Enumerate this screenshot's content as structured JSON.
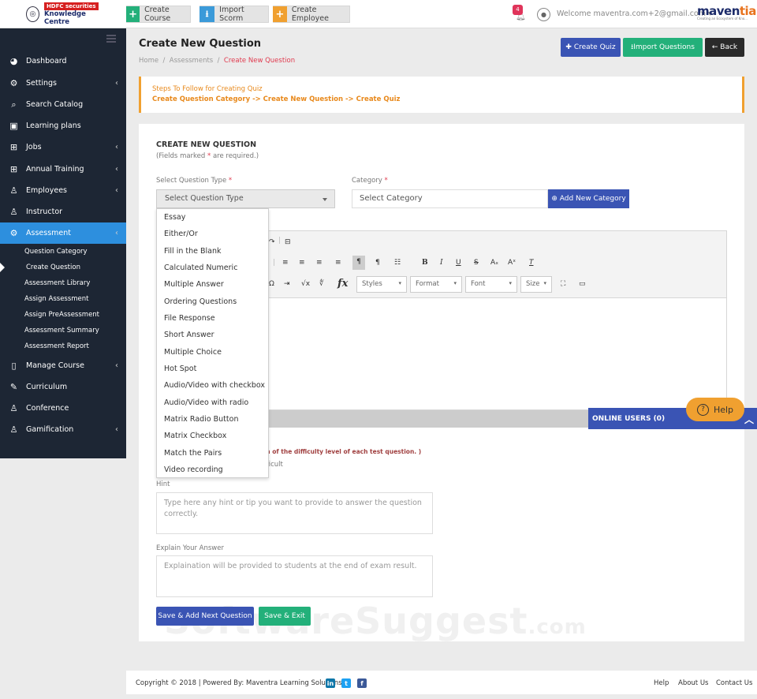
{
  "topbar": {
    "logo_line1": "HDFC securities",
    "logo_line2": "Knowledge Centre",
    "create_course": "Create Course",
    "import_scorm": "Import Scorm",
    "create_employee": "Create Employee",
    "notif_count": "4",
    "welcome": "Welcome maventra.com+2@gmail.com",
    "brand_main": "maven",
    "brand_accent": "tia",
    "brand_tag": "Creating an Ecosystem of Kno..."
  },
  "sidebar": {
    "items": [
      {
        "label": "Dashboard",
        "icon": "dashboard-icon"
      },
      {
        "label": "Settings",
        "icon": "gear-icon"
      },
      {
        "label": "Search Catalog",
        "icon": "search-icon"
      },
      {
        "label": "Learning plans",
        "icon": "learning-icon"
      },
      {
        "label": "Jobs",
        "icon": "grid-icon"
      },
      {
        "label": "Annual Training",
        "icon": "grid-icon"
      },
      {
        "label": "Employees",
        "icon": "users-icon"
      },
      {
        "label": "Instructor",
        "icon": "user-icon"
      },
      {
        "label": "Assessment",
        "icon": "gear-icon"
      },
      {
        "label": "Manage Course",
        "icon": "square-icon"
      },
      {
        "label": "Curriculum",
        "icon": "pencil-icon"
      },
      {
        "label": "Conference",
        "icon": "users-icon"
      },
      {
        "label": "Gamification",
        "icon": "users-icon"
      }
    ],
    "subitems": [
      "Question Category",
      "Create Question",
      "Assessment Library",
      "Assign Assessment",
      "Assign PreAssessment",
      "Assessment Summary",
      "Assessment Report"
    ]
  },
  "header": {
    "title": "Create New Question",
    "crumb_home": "Home",
    "crumb_sep": "/",
    "crumb_assess": "Assessments",
    "crumb_current": "Create New Question",
    "create_quiz": "Create Quiz",
    "import_questions": "Import Questions",
    "back": "Back"
  },
  "steps": {
    "title": "Steps To Follow for Creating Quiz",
    "flow": "Create Question Category -> Create New Question -> Create Quiz"
  },
  "form": {
    "heading": "CREATE NEW QUESTION",
    "note_pre": "(Fields marked ",
    "note_star": "*",
    "note_post": " are required.)",
    "qtype_label": "Select Question Type",
    "qtype_value": "Select Question Type",
    "category_label": "Category",
    "category_placeholder": "Select Category",
    "add_category": "Add New Category",
    "difficulty_note": "tion of the difficulty level of each test question. )",
    "difficulty_option": "Difficult",
    "hint_label": "Hint",
    "hint_placeholder": "Type here any hint or tip you want to provide to answer the question correctly.",
    "explain_label": "Explain Your Answer",
    "explain_placeholder": "Explaination will be provided to students at the end of exam result.",
    "save_next": "Save & Add Next Question",
    "save_exit": "Save & Exit"
  },
  "editor": {
    "styles": "Styles",
    "format": "Format",
    "font": "Font",
    "size": "Size"
  },
  "dropdown": {
    "options": [
      "Essay",
      "Either/Or",
      "Fill in the Blank",
      "Calculated Numeric",
      "Multiple Answer",
      "Ordering Questions",
      "File Response",
      "Short Answer",
      "Multiple Choice",
      "Hot Spot",
      "Audio/Video with checkbox",
      "Audio/Video with radio",
      "Matrix Radio Button",
      "Matrix Checkbox",
      "Match the Pairs",
      "Video recording"
    ]
  },
  "widgets": {
    "online_users": "ONLINE USERS (0)",
    "help": "Help"
  },
  "watermark": {
    "main": "SoftwareSuggest",
    "suffix": ".com"
  },
  "footer": {
    "copyright": "Copyright © 2018 | Powered By: Maventra Learning Solutions",
    "help": "Help",
    "about": "About Us",
    "contact": "Contact Us"
  },
  "colors": {
    "sidebar_bg": "#1d2634",
    "active": "#2d8fde",
    "primary": "#3a54b4",
    "success": "#23b07a",
    "warning": "#f0a030"
  }
}
